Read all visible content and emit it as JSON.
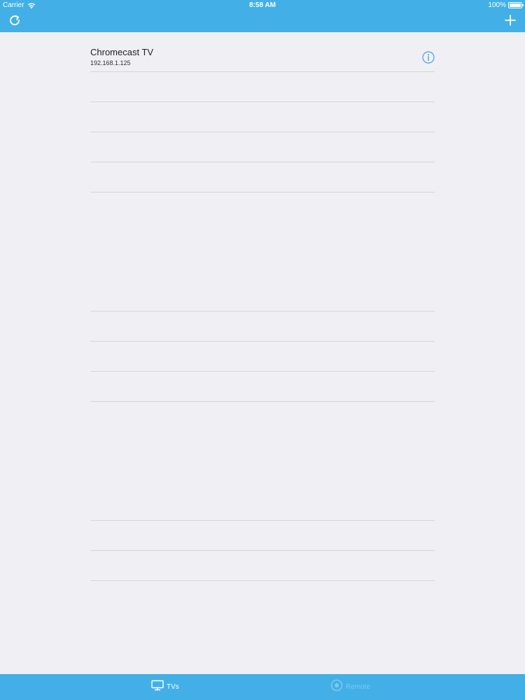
{
  "status_bar": {
    "carrier": "Carrier",
    "time": "8:58 AM",
    "battery": "100%",
    "wifi_icon": "wifi-icon",
    "battery_icon": "battery-icon"
  },
  "nav_bar": {
    "refresh_icon": "refresh-icon",
    "add_icon": "plus-icon"
  },
  "devices": [
    {
      "name": "Chromecast TV",
      "ip": "192.168.1.125",
      "info_icon": "info-icon"
    }
  ],
  "tab_bar": {
    "tabs": [
      {
        "label": "TVs",
        "icon": "tv-icon",
        "selected": true
      },
      {
        "label": "Remote",
        "icon": "remote-icon",
        "selected": false
      }
    ]
  },
  "colors": {
    "accent": "#42b0e6",
    "background": "#efeff4",
    "separator": "#d6d6da",
    "info_blue": "#4a9fe0"
  }
}
